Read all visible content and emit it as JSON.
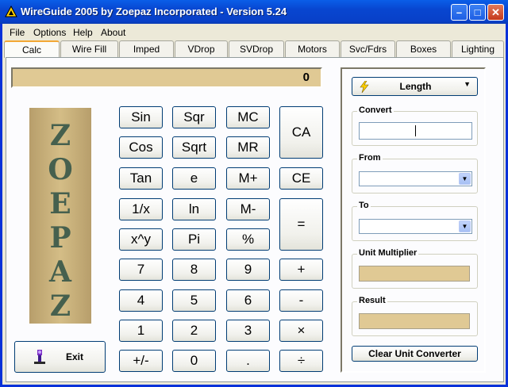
{
  "window": {
    "title": "WireGuide 2005 by Zoepaz Incorporated - Version 5.24"
  },
  "menu": [
    "File",
    "Options",
    "Help",
    "About"
  ],
  "tabs": [
    "Calc",
    "Wire Fill",
    "Imped",
    "VDrop",
    "SVDrop",
    "Motors",
    "Svc/Fdrs",
    "Boxes",
    "Lighting"
  ],
  "calculator": {
    "display": "0",
    "logo_letters": [
      "Z",
      "O",
      "E",
      "P",
      "A",
      "Z"
    ],
    "col1": [
      "Sin",
      "Cos",
      "Tan",
      "1/x",
      "x^y",
      "7",
      "4",
      "1",
      "+/-"
    ],
    "col2": [
      "Sqr",
      "Sqrt",
      "e",
      "ln",
      "Pi",
      "8",
      "5",
      "2",
      "0"
    ],
    "col3": [
      "MC",
      "MR",
      "M+",
      "M-",
      "%",
      "9",
      "6",
      "3",
      "."
    ],
    "col4": {
      "ca": "CA",
      "ce": "CE",
      "equals": "=",
      "plus": "+",
      "minus": "-",
      "times": "×",
      "divide": "÷"
    },
    "exit_label": "Exit"
  },
  "converter": {
    "type_label": "Length",
    "convert_label": "Convert",
    "convert_value": "",
    "from_label": "From",
    "from_value": "",
    "to_label": "To",
    "to_value": "",
    "multiplier_label": "Unit Multiplier",
    "result_label": "Result",
    "clear_label": "Clear Unit Converter"
  },
  "colors": {
    "titlebar": "#0a5ee8",
    "display_bg": "#e0c994",
    "logo_text": "#46604e"
  }
}
